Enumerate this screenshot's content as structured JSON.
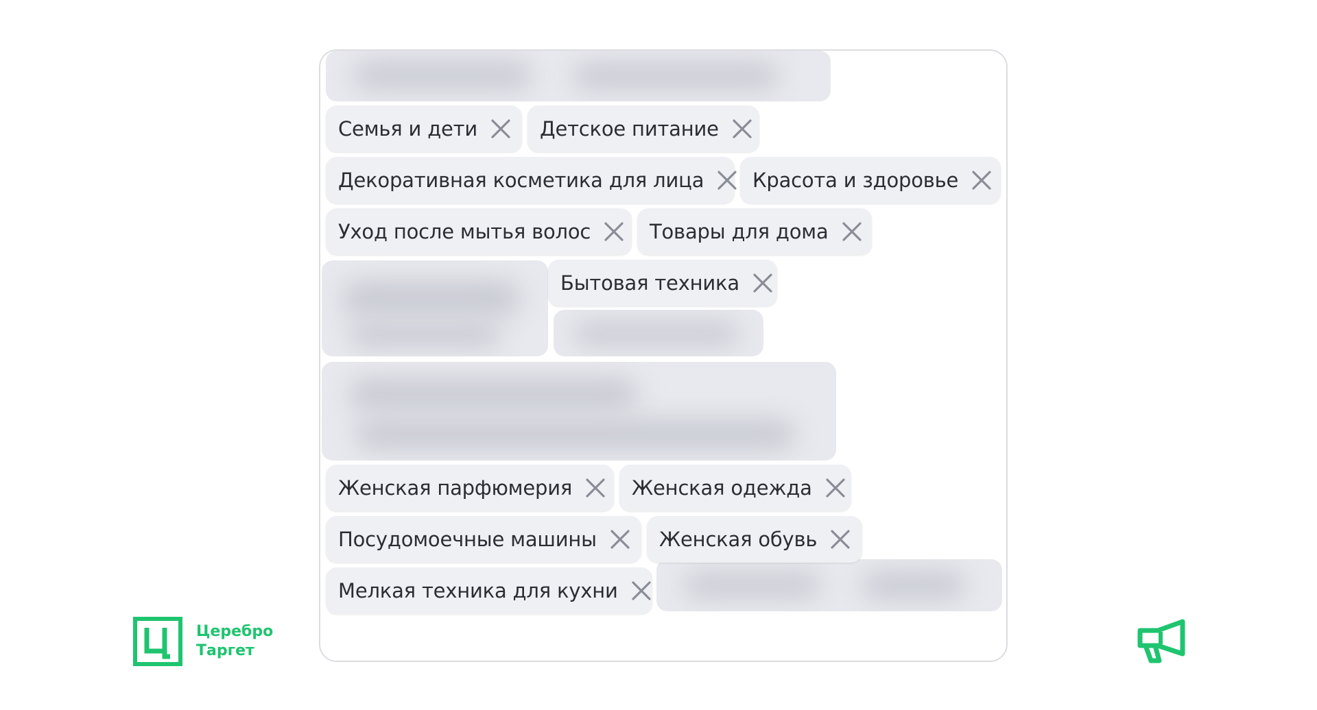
{
  "chips": [
    {
      "label": "Семья и дети"
    },
    {
      "label": "Детское питание"
    },
    {
      "label": "Декоративная косметика для лица"
    },
    {
      "label": "Красота и здоровье"
    },
    {
      "label": "Уход после мытья волос"
    },
    {
      "label": "Товары для дома"
    },
    {
      "label": "Бытовая техника"
    },
    {
      "label": "Женская парфюмерия"
    },
    {
      "label": "Женская одежда"
    },
    {
      "label": "Посудомоечные машины"
    },
    {
      "label": "Женская обувь"
    },
    {
      "label": "Мелкая техника для кухни"
    }
  ],
  "icons": {
    "chip_remove": "close-icon",
    "brand": "cerebro-logo-icon",
    "corner": "megaphone-icon"
  },
  "brand": {
    "line1": "Церебро",
    "line2": "Таргет",
    "color": "#1fc46f"
  },
  "colors": {
    "chip_bg": "#eff0f4",
    "chip_text": "#2c2d33",
    "close_icon": "#8a8c96",
    "card_border": "#dcdde1"
  }
}
